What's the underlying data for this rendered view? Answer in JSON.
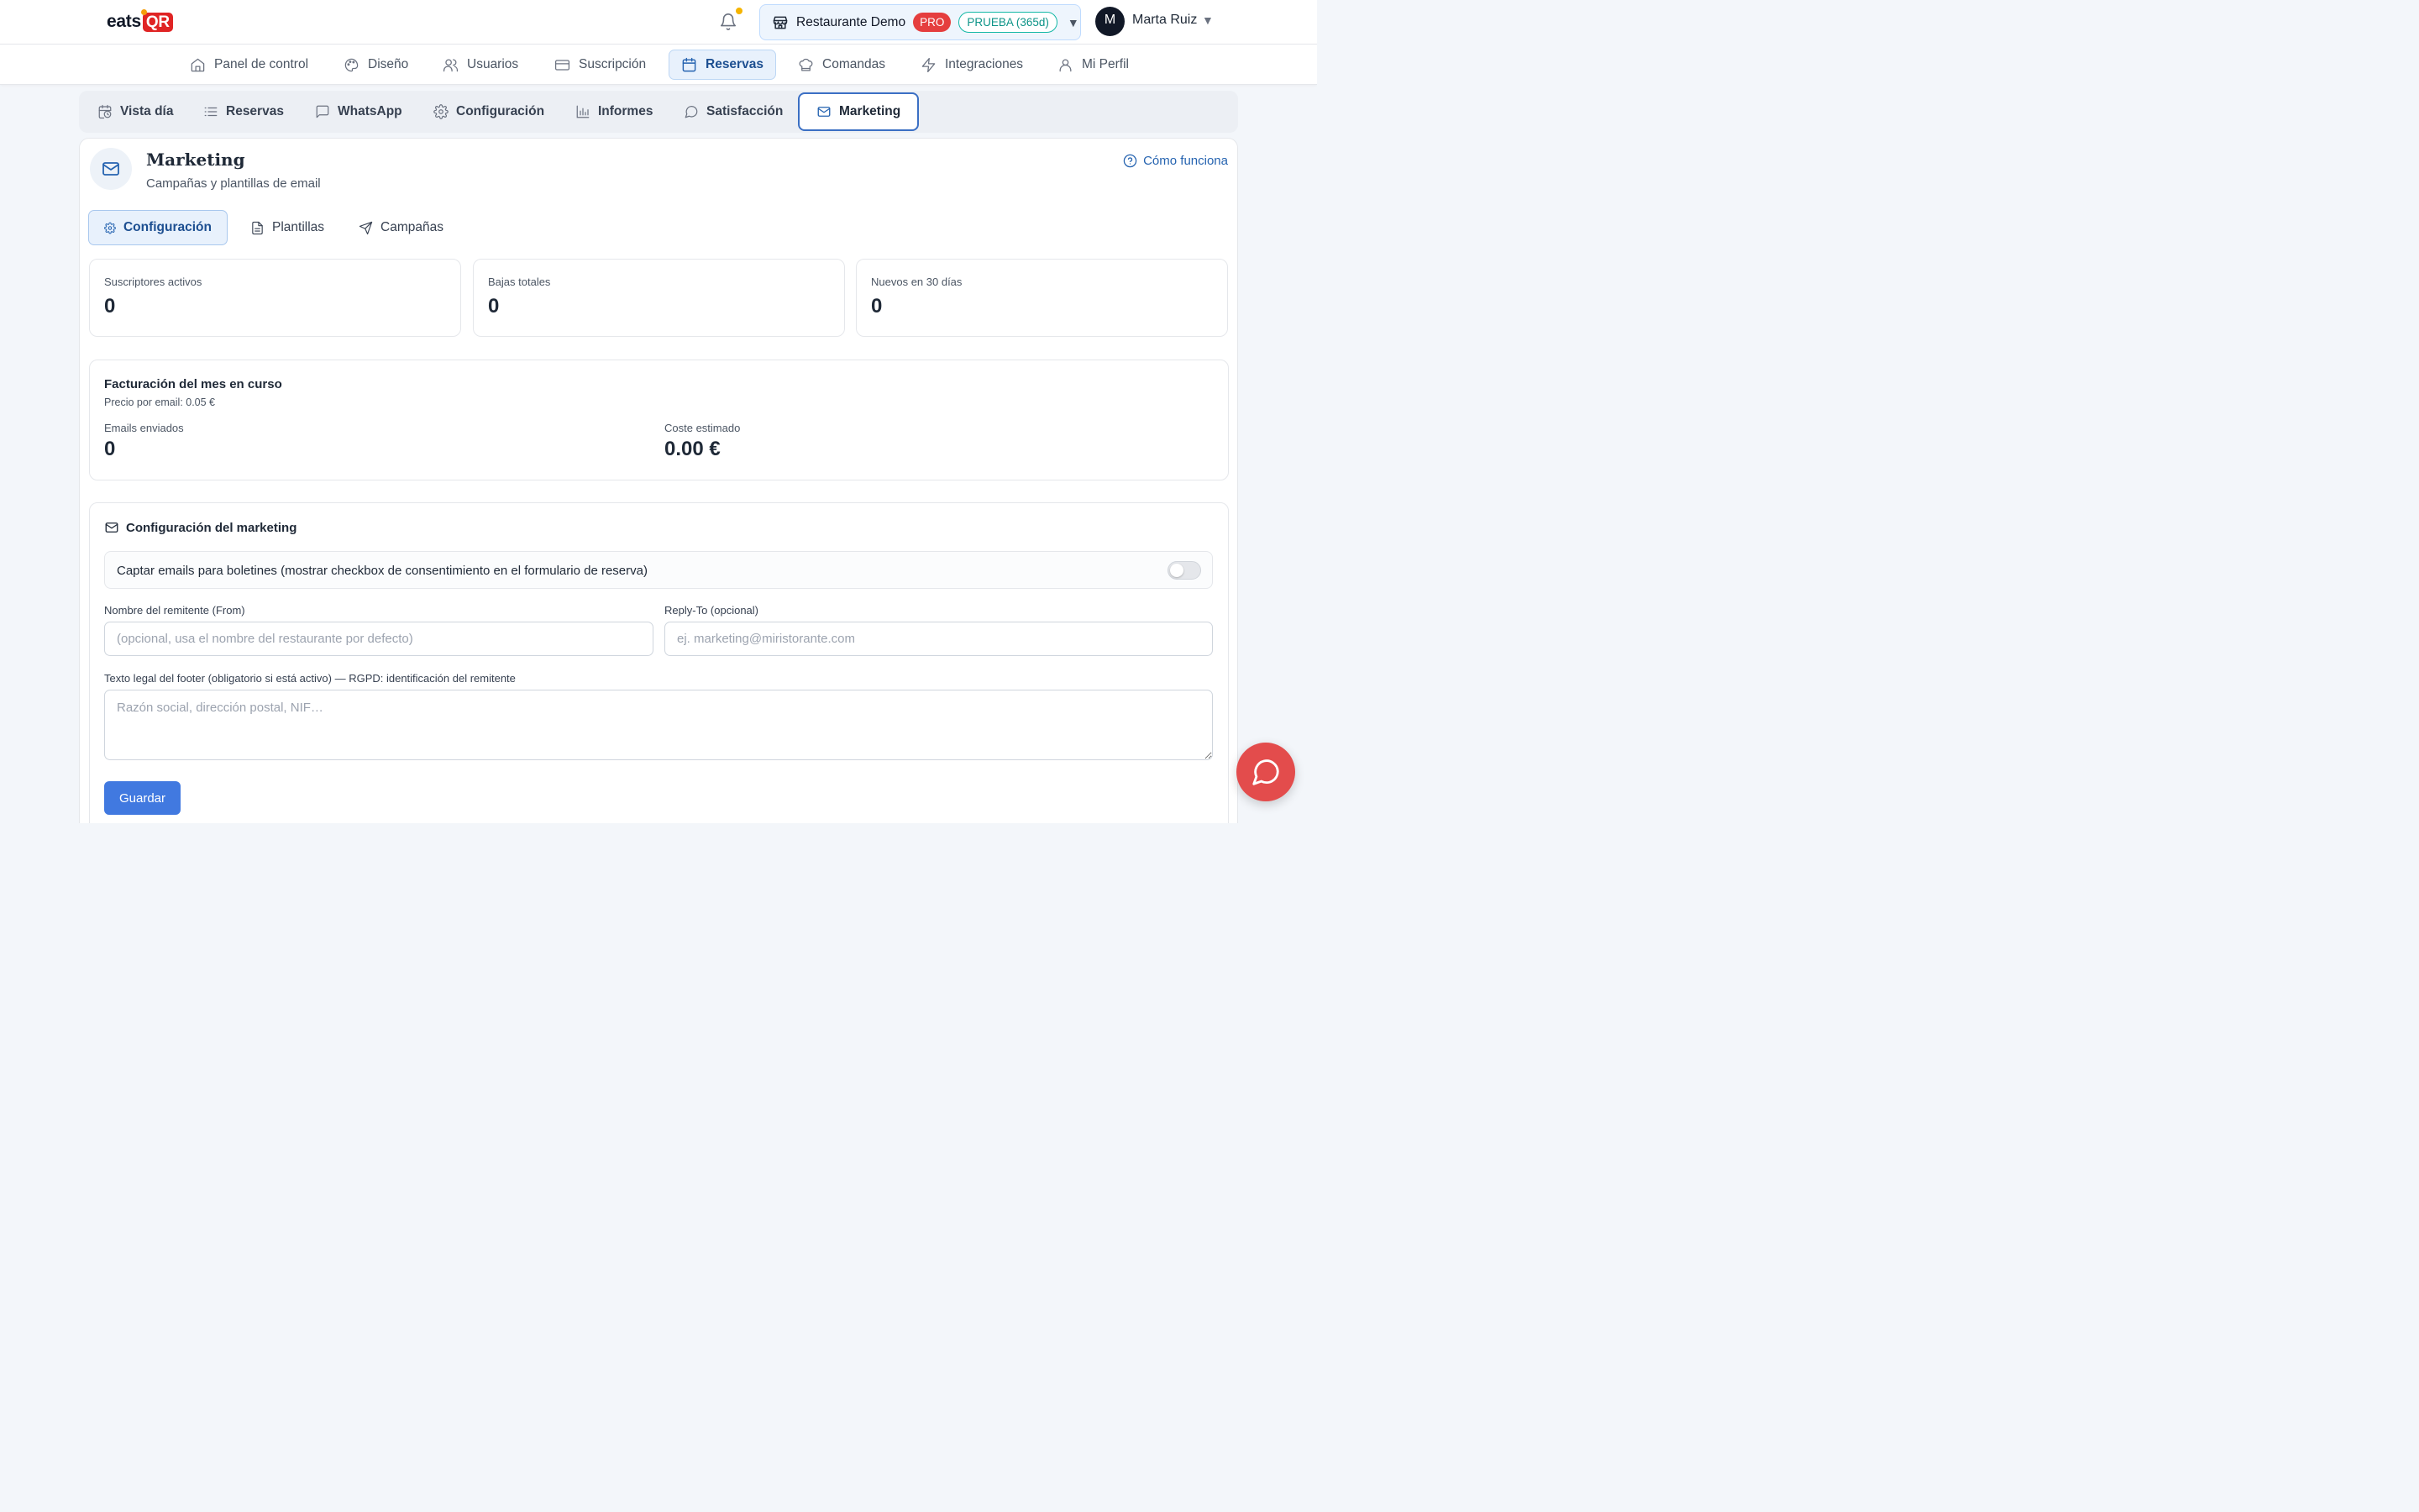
{
  "brand": {
    "logo_left": "eats",
    "logo_box": "QR"
  },
  "topbar": {
    "restaurant_name": "Restaurante Demo",
    "plan_badge": "PRO",
    "trial_badge": "PRUEBA (365d)",
    "dropdown_caret": "▼",
    "avatar_initial": "M",
    "user_name": "Marta Ruiz",
    "user_caret": "▼"
  },
  "main_nav": [
    {
      "label": "Panel de control",
      "icon": "home-icon"
    },
    {
      "label": "Diseño",
      "icon": "palette-icon"
    },
    {
      "label": "Usuarios",
      "icon": "users-icon"
    },
    {
      "label": "Suscripción",
      "icon": "credit-card-icon"
    },
    {
      "label": "Reservas",
      "icon": "calendar-icon",
      "active": true
    },
    {
      "label": "Comandas",
      "icon": "chef-hat-icon"
    },
    {
      "label": "Integraciones",
      "icon": "lightning-icon"
    },
    {
      "label": "Mi Perfil",
      "icon": "user-icon"
    }
  ],
  "sub_nav": [
    {
      "label": "Vista día",
      "icon": "calendar-clock-icon"
    },
    {
      "label": "Reservas",
      "icon": "list-icon"
    },
    {
      "label": "WhatsApp",
      "icon": "message-square-icon"
    },
    {
      "label": "Configuración",
      "icon": "gear-icon"
    },
    {
      "label": "Informes",
      "icon": "bar-chart-icon"
    },
    {
      "label": "Satisfacción",
      "icon": "message-circle-icon"
    },
    {
      "label": "Marketing",
      "icon": "mail-icon",
      "active": true
    }
  ],
  "page": {
    "title": "Marketing",
    "subtitle": "Campañas y plantillas de email",
    "help_link": "Cómo funciona"
  },
  "tabs": [
    {
      "label": "Configuración",
      "icon": "gear-icon",
      "active": true
    },
    {
      "label": "Plantillas",
      "icon": "file-icon"
    },
    {
      "label": "Campañas",
      "icon": "send-icon"
    }
  ],
  "stats": [
    {
      "label": "Suscriptores activos",
      "value": "0"
    },
    {
      "label": "Bajas totales",
      "value": "0"
    },
    {
      "label": "Nuevos en 30 días",
      "value": "0"
    }
  ],
  "billing": {
    "title": "Facturación del mes en curso",
    "price_line": "Precio por email: 0.05 €",
    "emails_label": "Emails enviados",
    "emails_value": "0",
    "cost_label": "Coste estimado",
    "cost_value": "0.00 €"
  },
  "marketing_config": {
    "title": "Configuración del marketing",
    "consent_label": "Captar emails para boletines (mostrar checkbox de consentimiento en el formulario de reserva)",
    "consent_enabled": false,
    "from_label": "Nombre del remitente (From)",
    "from_value": "",
    "from_placeholder": "(opcional, usa el nombre del restaurante por defecto)",
    "replyto_label": "Reply-To (opcional)",
    "replyto_value": "",
    "replyto_placeholder": "ej. marketing@miristorante.com",
    "footer_label": "Texto legal del footer (obligatorio si está activo) — RGPD: identificación del remitente",
    "footer_value": "",
    "footer_placeholder": "Razón social, dirección postal, NIF…",
    "save_label": "Guardar"
  },
  "colors": {
    "brand_red": "#e02424",
    "accent_blue": "#4179e0",
    "active_nav_bg": "#e8f1fc",
    "trial_teal": "#0d9488",
    "chat_bubble": "#e34c4c"
  }
}
